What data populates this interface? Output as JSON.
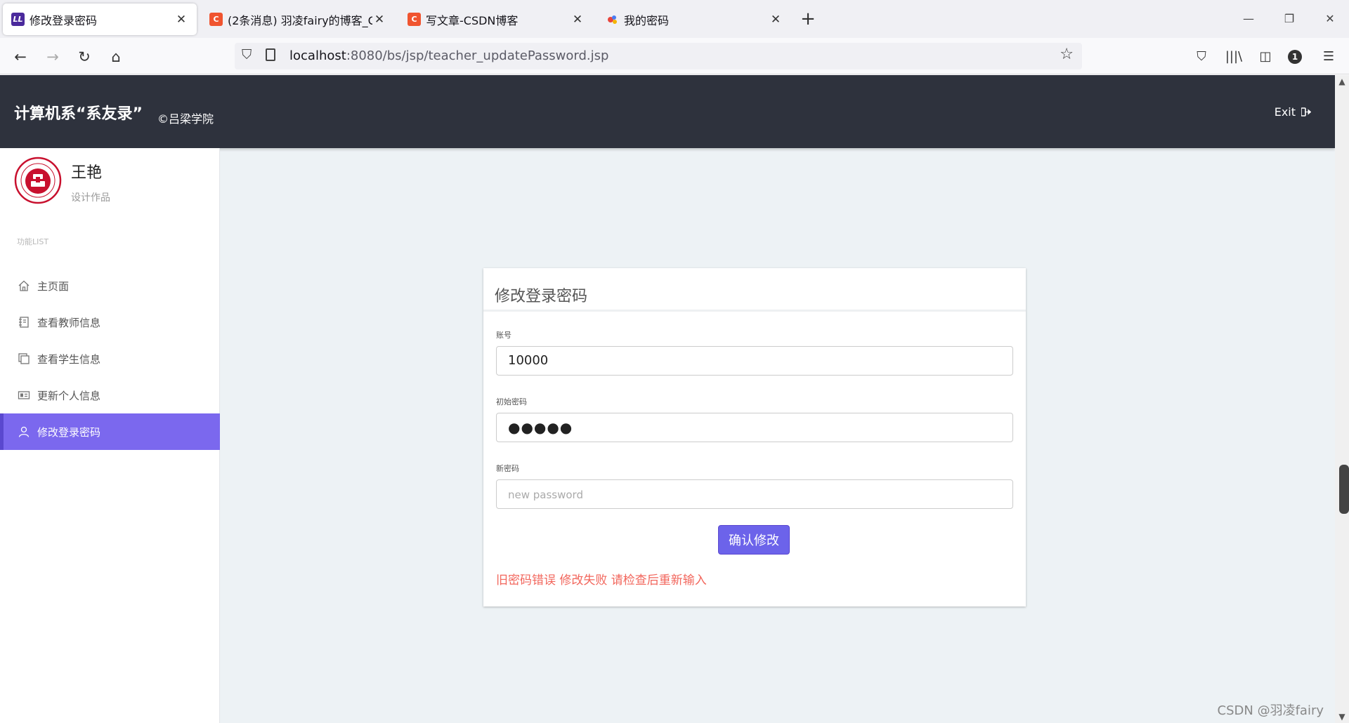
{
  "browser": {
    "tabs": [
      {
        "label": "修改登录密码",
        "icon": "ll-logo-icon",
        "fav_text": "LL",
        "active": true
      },
      {
        "label": "(2条消息) 羽凌fairy的博客_CSD",
        "icon": "csdn-c-icon",
        "fav_text": "C",
        "active": false
      },
      {
        "label": "写文章-CSDN博客",
        "icon": "csdn-c-icon",
        "fav_text": "C",
        "active": false
      },
      {
        "label": "我的密码",
        "icon": "key-icon",
        "fav_text": "",
        "active": false
      }
    ],
    "url_host": "localhost",
    "url_rest": ":8080/bs/jsp/teacher_updatePassword.jsp",
    "account_badge": "1"
  },
  "header": {
    "brand": "计算机系“系友录”",
    "subtitle": "©吕梁学院",
    "exit_label": "Exit"
  },
  "sidebar": {
    "user_name": "王艳",
    "user_role": "设计作品",
    "menu_title": "功能LIST",
    "items": [
      {
        "label": "主页面",
        "icon": "home-icon",
        "active": false
      },
      {
        "label": "查看教师信息",
        "icon": "notebook-icon",
        "active": false
      },
      {
        "label": "查看学生信息",
        "icon": "copy-icon",
        "active": false
      },
      {
        "label": "更新个人信息",
        "icon": "id-card-icon",
        "active": false
      },
      {
        "label": "修改登录密码",
        "icon": "user-icon",
        "active": true
      }
    ]
  },
  "form": {
    "title": "修改登录密码",
    "account_label": "账号",
    "account_value": "10000",
    "old_password_label": "初始密码",
    "old_password_mask": "●●●●●",
    "new_password_label": "新密码",
    "new_password_placeholder": "new password",
    "submit_label": "确认修改",
    "error_message": "旧密码错误 修改失败 请检查后重新输入"
  },
  "watermark": "CSDN @羽凌fairy",
  "colors": {
    "header_bg": "#2e323d",
    "accent": "#7b68ee",
    "error": "#f2665c",
    "page_bg": "#edf2f5"
  }
}
